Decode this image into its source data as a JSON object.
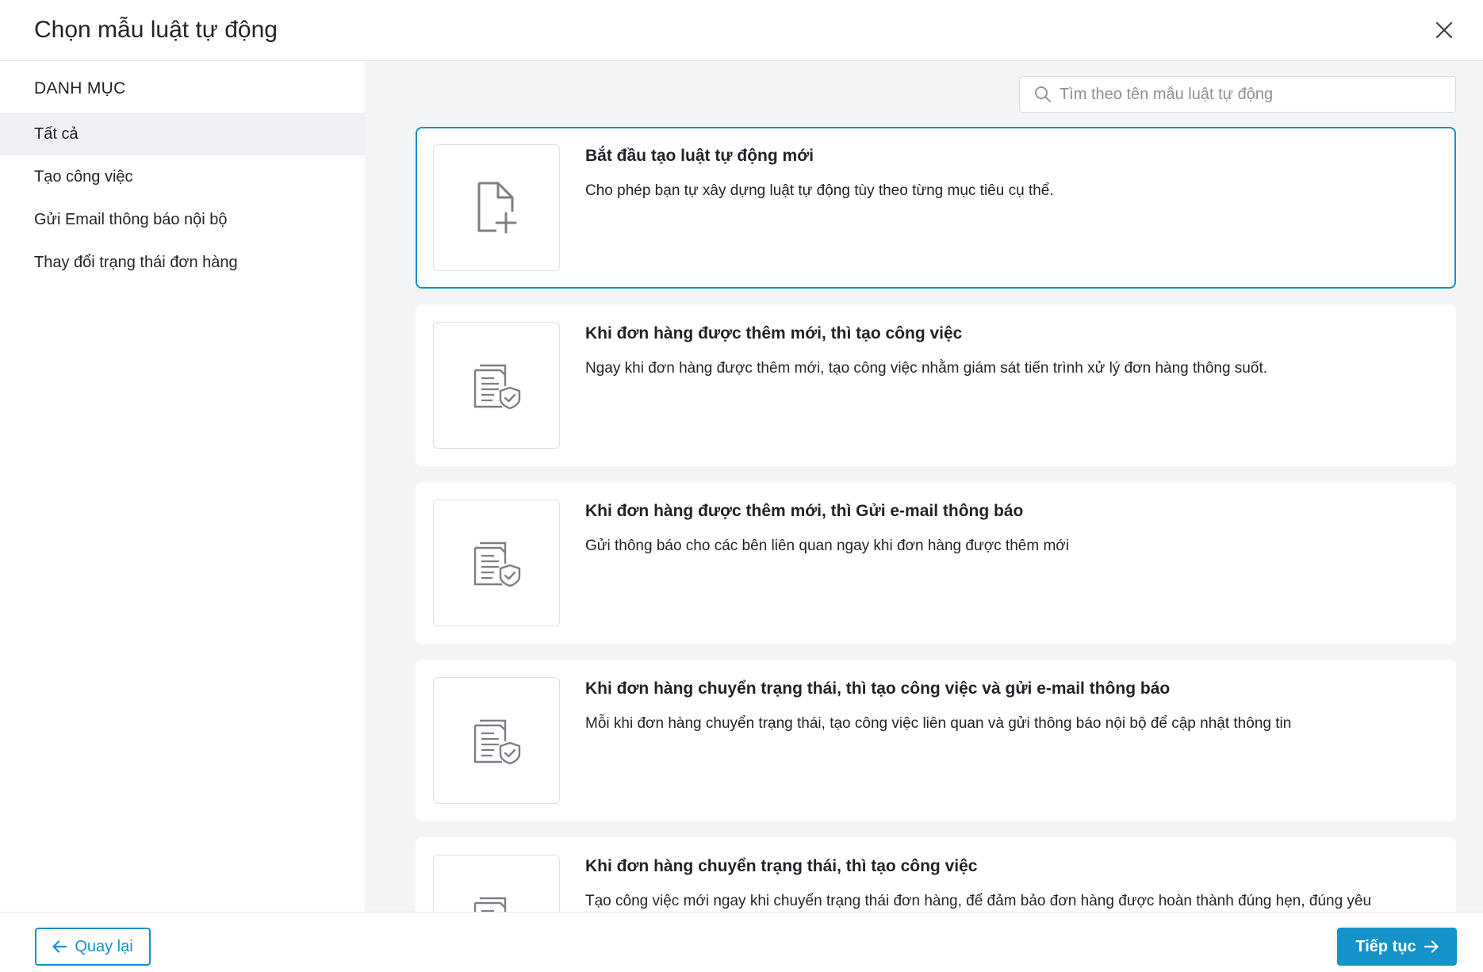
{
  "header": {
    "title": "Chọn mẫu luật tự động",
    "close_icon": "close-icon"
  },
  "sidebar": {
    "heading": "DANH MỤC",
    "items": [
      {
        "label": "Tất cả",
        "active": true
      },
      {
        "label": "Tạo công việc",
        "active": false
      },
      {
        "label": "Gửi Email thông báo nội bộ",
        "active": false
      },
      {
        "label": "Thay đổi trạng thái đơn hàng",
        "active": false
      }
    ]
  },
  "search": {
    "placeholder": "Tìm theo tên mẫu luật tự động",
    "value": "",
    "icon": "search-icon"
  },
  "cards": [
    {
      "title": "Bắt đầu tạo luật tự động mới",
      "description": "Cho phép bạn tự xây dựng luật tự động tùy theo từng mục tiêu cụ thể.",
      "icon": "new-file-icon",
      "selected": true
    },
    {
      "title": "Khi đơn hàng được thêm mới, thì tạo công việc",
      "description": "Ngay khi đơn hàng được thêm mới, tạo công việc nhằm giám sát tiến trình xử lý đơn hàng thông suốt.",
      "icon": "document-shield-icon",
      "selected": false
    },
    {
      "title": "Khi đơn hàng được thêm mới, thì Gửi e-mail thông báo",
      "description": "Gửi thông báo cho các bên liên quan ngay khi đơn hàng được thêm mới",
      "icon": "document-shield-icon",
      "selected": false
    },
    {
      "title": "Khi đơn hàng chuyển trạng thái, thì tạo công việc và gửi e-mail thông báo",
      "description": "Mỗi khi đơn hàng chuyển trạng thái, tạo công việc liên quan và gửi thông báo nội bộ để cập nhật thông tin",
      "icon": "document-shield-icon",
      "selected": false
    },
    {
      "title": "Khi đơn hàng chuyển trạng thái, thì tạo công việc",
      "description": "Tạo công việc mới ngay khi chuyển trạng thái đơn hàng, để đảm bảo đơn hàng được hoàn thành đúng hẹn, đúng yêu",
      "icon": "document-shield-icon",
      "selected": false
    }
  ],
  "footer": {
    "back_label": "Quay lại",
    "next_label": "Tiếp tục"
  },
  "colors": {
    "accent": "#1592c8",
    "main_bg": "#f3f4f6",
    "active_item_bg": "#eef0f3"
  }
}
